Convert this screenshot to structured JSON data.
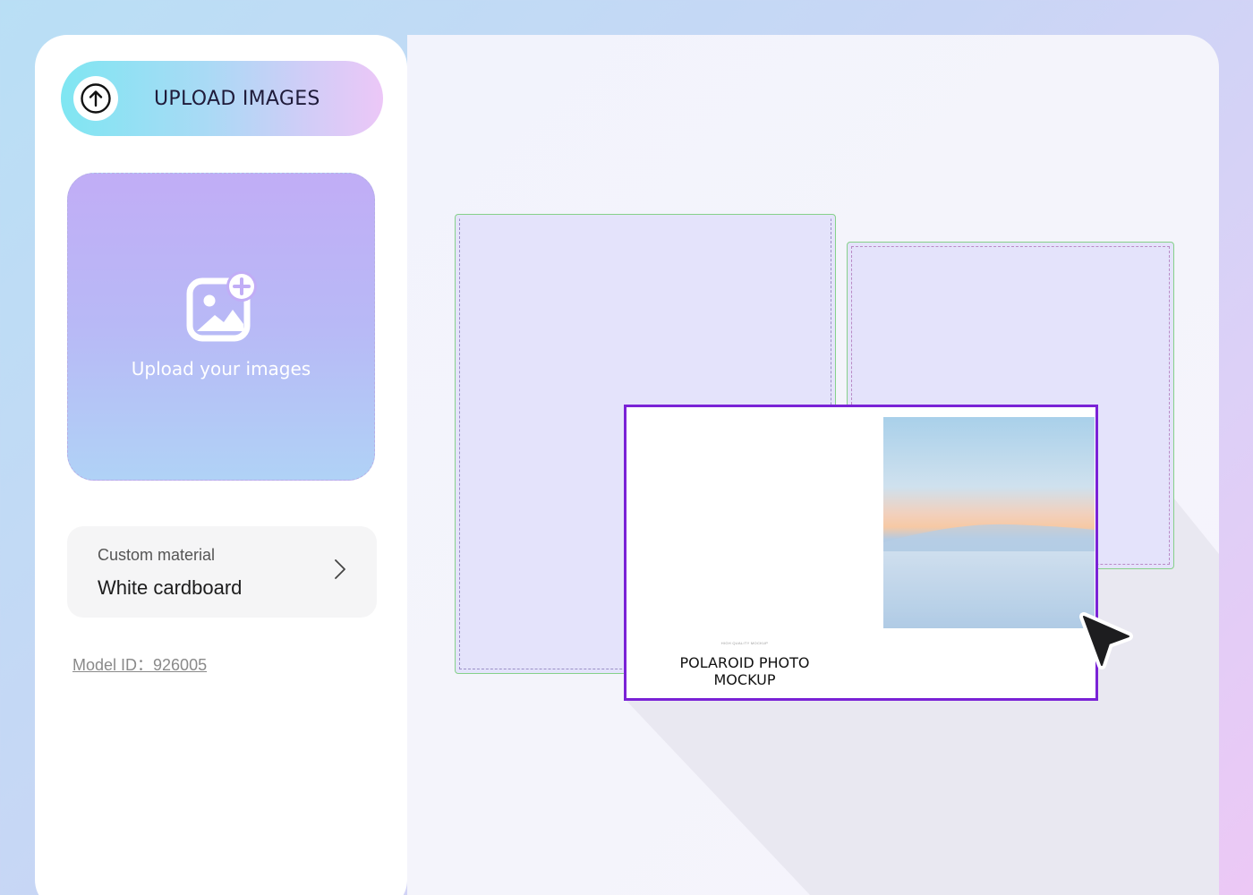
{
  "sidebar": {
    "upload_button_label": "UPLOAD IMAGES",
    "dropzone_label": "Upload your images",
    "material": {
      "caption": "Custom material",
      "value": "White cardboard"
    },
    "model_id": "Model ID：926005"
  },
  "canvas": {
    "mockup_tagline": "HIGH QUALITY MOCKUP",
    "mockup_title_line1": "POLAROID PHOTO",
    "mockup_title_line2": "MOCKUP"
  },
  "colors": {
    "selection_outline": "#7a22d6",
    "frame_outline": "#86d18a"
  },
  "icons": {
    "upload": "arrow-up-circle-icon",
    "add_image": "image-plus-icon",
    "chevron": "chevron-right-icon",
    "pointer": "cursor-arrow-icon"
  }
}
